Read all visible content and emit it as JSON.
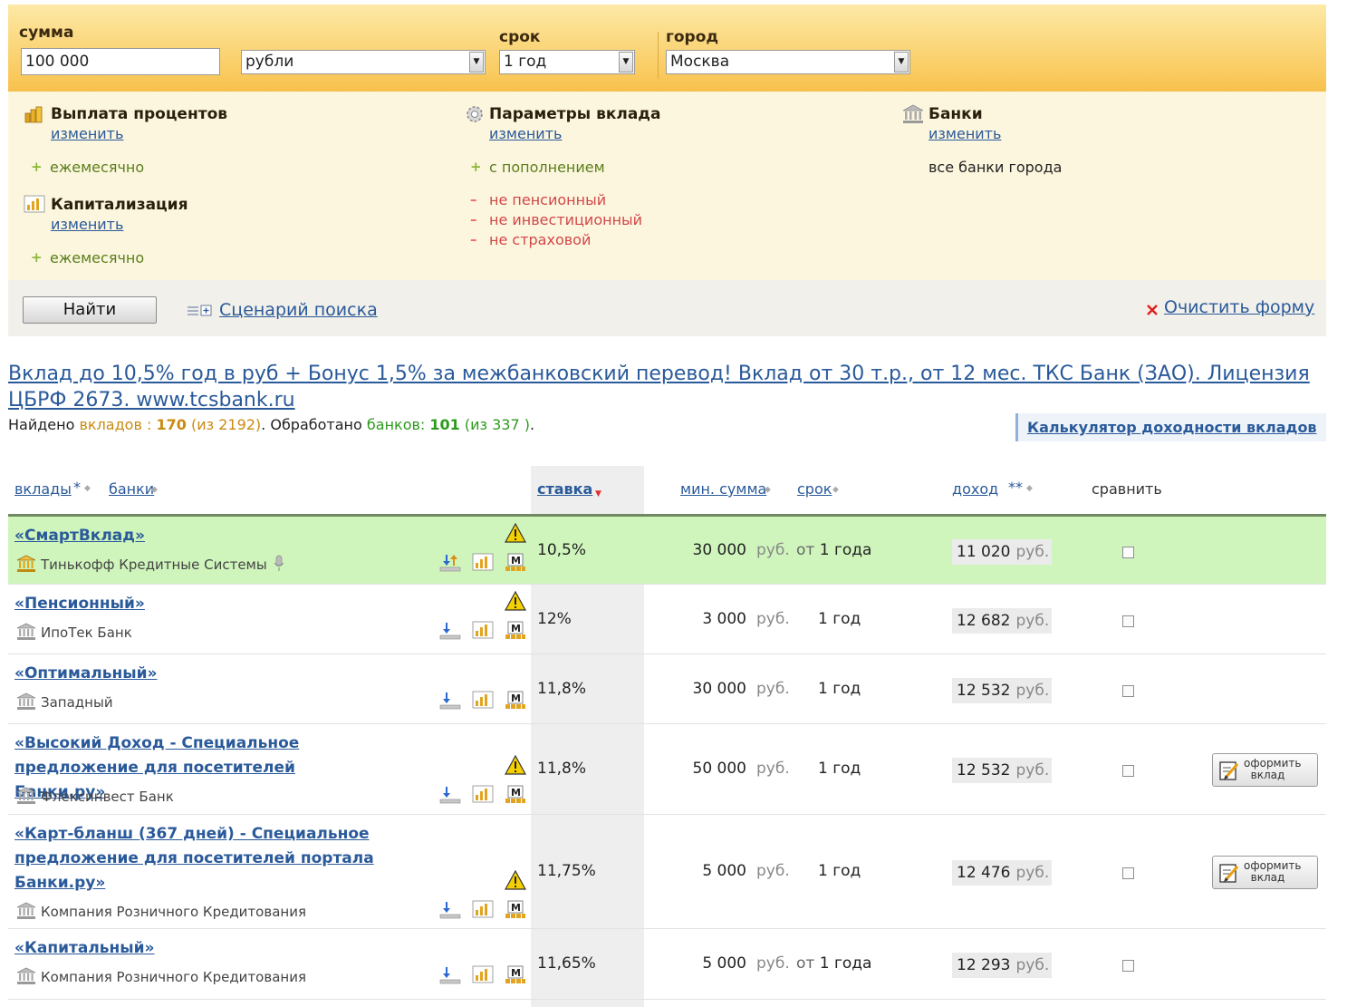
{
  "search": {
    "amount_label": "сумма",
    "amount_value": "100 000",
    "currency_value": "рубли",
    "term_label": "срок",
    "term_value": "1 год",
    "city_label": "город",
    "city_value": "Москва"
  },
  "params": {
    "interest_payment": {
      "title": "Выплата процентов",
      "change": "изменить",
      "value": "ежемесячно"
    },
    "capitalization": {
      "title": "Капитализация",
      "change": "изменить",
      "value": "ежемесячно"
    },
    "deposit_params": {
      "title": "Параметры вклада",
      "change": "изменить",
      "plus": [
        "с пополнением"
      ],
      "minus": [
        "не пенсионный",
        "не инвестиционный",
        "не страховой"
      ]
    },
    "banks": {
      "title": "Банки",
      "change": "изменить",
      "value": "все банки города"
    }
  },
  "actions": {
    "find": "Найти",
    "scenario": "Сценарий поиска",
    "clear": "Очистить форму"
  },
  "ad": {
    "text": "Вклад до 10,5% год в руб + Бонус 1,5% за межбанковский перевод! Вклад от 30 т.р., от 12 мес. ТКС Банк (ЗАО). Лицензия ЦБРФ 2673. www.tcsbank.ru"
  },
  "summary": {
    "found": "Найдено",
    "deposits_word": "вкладов :",
    "deposits_count": "170",
    "deposits_total": "(из 2192)",
    "processed": ". Обработано",
    "banks_word": "банков:",
    "banks_count": "101",
    "banks_total": "(из 337 )",
    "tail": "."
  },
  "calc_link": "Калькулятор доходности вкладов",
  "table": {
    "headers": {
      "deposits": "вклады",
      "deposits_mark": "*",
      "banks": "банки",
      "rate": "ставка",
      "min_sum": "мин. сумма",
      "term": "срок",
      "income": "доход",
      "income_mark": "**",
      "compare": "сравнить"
    },
    "currency": "руб.",
    "apply_label_1": "оформить",
    "apply_label_2": "вклад",
    "rows": [
      {
        "name": "«СмартВклад»",
        "bank": "Тинькофф Кредитные Системы",
        "rate": "10,5%",
        "min_sum": "30 000",
        "term_prefix": "от",
        "term": "1 года",
        "income": "11 020"
      },
      {
        "name": "«Пенсионный»",
        "bank": "ИпоТек Банк",
        "rate": "12%",
        "min_sum": "3 000",
        "term_prefix": "",
        "term": "1 год",
        "income": "12 682"
      },
      {
        "name": "«Оптимальный»",
        "bank": "Западный",
        "rate": "11,8%",
        "min_sum": "30 000",
        "term_prefix": "",
        "term": "1 год",
        "income": "12 532"
      },
      {
        "name": "«Высокий Доход - Специальное предложение для посетителей Банки.ру»",
        "bank": "Флексинвест Банк",
        "rate": "11,8%",
        "min_sum": "50 000",
        "term_prefix": "",
        "term": "1 год",
        "income": "12 532"
      },
      {
        "name": "«Карт-бланш (367 дней) - Специальное предложение для посетителей портала Банки.ру»",
        "bank": "Компания Розничного Кредитования",
        "rate": "11,75%",
        "min_sum": "5 000",
        "term_prefix": "",
        "term": "1 год",
        "income": "12 476"
      },
      {
        "name": "«Капитальный»",
        "bank": "Компания Розничного Кредитования",
        "rate": "11,65%",
        "min_sum": "5 000",
        "term_prefix": "от",
        "term": "1 года",
        "income": "12 293"
      }
    ]
  }
}
